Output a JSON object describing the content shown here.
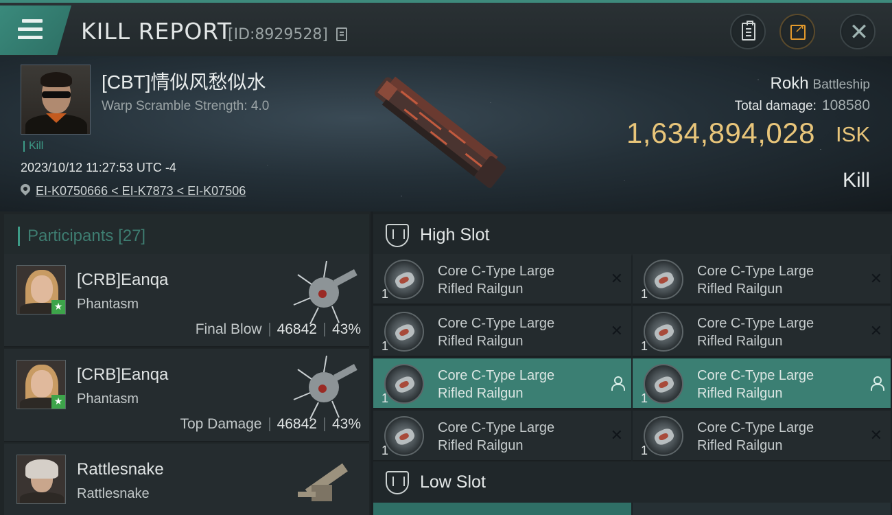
{
  "header": {
    "title": "KILL REPORT",
    "report_id": "[ID:8929528]"
  },
  "victim": {
    "name": "[CBT]情似风愁似水",
    "warp_scramble": "Warp Scramble Strength: 4.0",
    "tag": "Kill",
    "timestamp": "2023/10/12 11:27:53 UTC -4",
    "location": "EI-K0750666 < EI-K7873 < EI-K07506",
    "ship_name": "Rokh",
    "ship_class": "Battleship",
    "total_damage_label": "Total damage:",
    "total_damage": "108580",
    "isk_value": "1,634,894,028",
    "isk_unit": "ISK",
    "result": "Kill"
  },
  "participants": {
    "label": "Participants",
    "count": "[27]",
    "rows": [
      {
        "name": "[CRB]Eanqa",
        "ship": "Phantasm",
        "role": "Final Blow",
        "damage": "46842",
        "percent": "43%"
      },
      {
        "name": "[CRB]Eanqa",
        "ship": "Phantasm",
        "role": "Top Damage",
        "damage": "46842",
        "percent": "43%"
      },
      {
        "name": "Rattlesnake",
        "ship": "Rattlesnake",
        "role": "",
        "damage": "",
        "percent": ""
      }
    ]
  },
  "slots": {
    "high_label": "High Slot",
    "low_label": "Low Slot",
    "high_modules": [
      {
        "qty": "1",
        "name_line1": "Core C-Type Large",
        "name_line2": "Rifled Railgun",
        "state": "destroyed"
      },
      {
        "qty": "1",
        "name_line1": "Core C-Type Large",
        "name_line2": "Rifled Railgun",
        "state": "destroyed"
      },
      {
        "qty": "1",
        "name_line1": "Core C-Type Large",
        "name_line2": "Rifled Railgun",
        "state": "destroyed"
      },
      {
        "qty": "1",
        "name_line1": "Core C-Type Large",
        "name_line2": "Rifled Railgun",
        "state": "destroyed"
      },
      {
        "qty": "1",
        "name_line1": "Core C-Type Large",
        "name_line2": "Rifled Railgun",
        "state": "dropped"
      },
      {
        "qty": "1",
        "name_line1": "Core C-Type Large",
        "name_line2": "Rifled Railgun",
        "state": "dropped"
      },
      {
        "qty": "1",
        "name_line1": "Core C-Type Large",
        "name_line2": "Rifled Railgun",
        "state": "destroyed"
      },
      {
        "qty": "1",
        "name_line1": "Core C-Type Large",
        "name_line2": "Rifled Railgun",
        "state": "destroyed"
      }
    ]
  },
  "colors": {
    "accent": "#3e9c88",
    "active_row": "#3b7f73",
    "isk_gold": "#e8c57a",
    "share_orange": "#e39a2c"
  },
  "icons": {
    "menu": "menu-icon",
    "copy": "copy-icon",
    "clipboard": "clipboard-icon",
    "share": "share-icon",
    "close": "close-icon",
    "location": "location-pin-icon",
    "slot": "shield-slot-icon",
    "destroyed": "x-icon",
    "dropped": "person-icon"
  }
}
